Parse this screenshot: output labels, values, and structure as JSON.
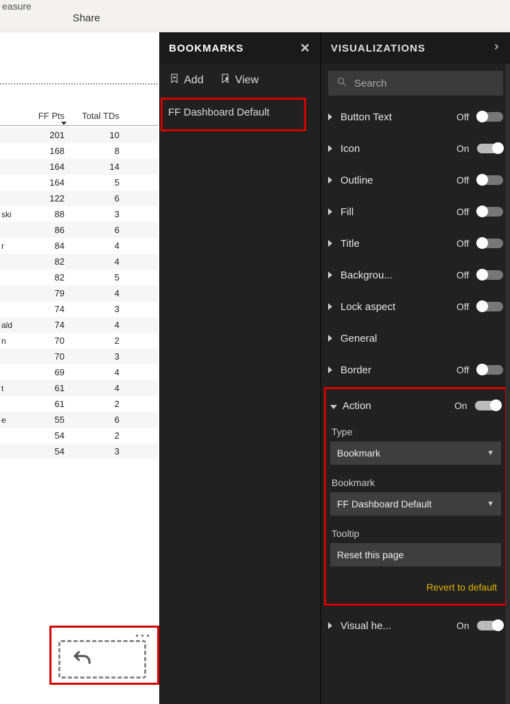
{
  "ribbon": {
    "fragment_text": "easure",
    "share": "Share"
  },
  "table": {
    "headers": {
      "col1": "FF Pts",
      "col2": "Total TDs"
    },
    "rows": [
      {
        "name": "",
        "pts": "201",
        "tds": "10"
      },
      {
        "name": "",
        "pts": "168",
        "tds": "8"
      },
      {
        "name": "",
        "pts": "164",
        "tds": "14"
      },
      {
        "name": "",
        "pts": "164",
        "tds": "5"
      },
      {
        "name": "",
        "pts": "122",
        "tds": "6"
      },
      {
        "name": "ski",
        "pts": "88",
        "tds": "3"
      },
      {
        "name": "",
        "pts": "86",
        "tds": "6"
      },
      {
        "name": "r",
        "pts": "84",
        "tds": "4"
      },
      {
        "name": "",
        "pts": "82",
        "tds": "4"
      },
      {
        "name": "",
        "pts": "82",
        "tds": "5"
      },
      {
        "name": "",
        "pts": "79",
        "tds": "4"
      },
      {
        "name": "",
        "pts": "74",
        "tds": "3"
      },
      {
        "name": "ald",
        "pts": "74",
        "tds": "4"
      },
      {
        "name": "n",
        "pts": "70",
        "tds": "2"
      },
      {
        "name": "",
        "pts": "70",
        "tds": "3"
      },
      {
        "name": "",
        "pts": "69",
        "tds": "4"
      },
      {
        "name": "t",
        "pts": "61",
        "tds": "4"
      },
      {
        "name": "",
        "pts": "61",
        "tds": "2"
      },
      {
        "name": "e",
        "pts": "55",
        "tds": "6"
      },
      {
        "name": "",
        "pts": "54",
        "tds": "2"
      },
      {
        "name": "",
        "pts": "54",
        "tds": "3"
      }
    ]
  },
  "bookmarks": {
    "title": "BOOKMARKS",
    "add": "Add",
    "view": "View",
    "items": [
      {
        "label": "FF Dashboard Default"
      }
    ]
  },
  "vis": {
    "title": "VISUALIZATIONS",
    "search_placeholder": "Search",
    "format": {
      "button_text": {
        "label": "Button Text",
        "state": "Off"
      },
      "icon": {
        "label": "Icon",
        "state": "On"
      },
      "outline": {
        "label": "Outline",
        "state": "Off"
      },
      "fill": {
        "label": "Fill",
        "state": "Off"
      },
      "title_opt": {
        "label": "Title",
        "state": "Off"
      },
      "background": {
        "label": "Backgrou...",
        "state": "Off"
      },
      "lock_aspect": {
        "label": "Lock aspect",
        "state": "Off"
      },
      "general": {
        "label": "General"
      },
      "border": {
        "label": "Border",
        "state": "Off"
      },
      "action": {
        "label": "Action",
        "state": "On"
      },
      "visual_header": {
        "label": "Visual he...",
        "state": "On"
      }
    },
    "action": {
      "type_label": "Type",
      "type_value": "Bookmark",
      "bookmark_label": "Bookmark",
      "bookmark_value": "FF Dashboard Default",
      "tooltip_label": "Tooltip",
      "tooltip_value": "Reset this page",
      "revert": "Revert to default"
    }
  },
  "reset_button": {
    "ellipsis": "···"
  }
}
